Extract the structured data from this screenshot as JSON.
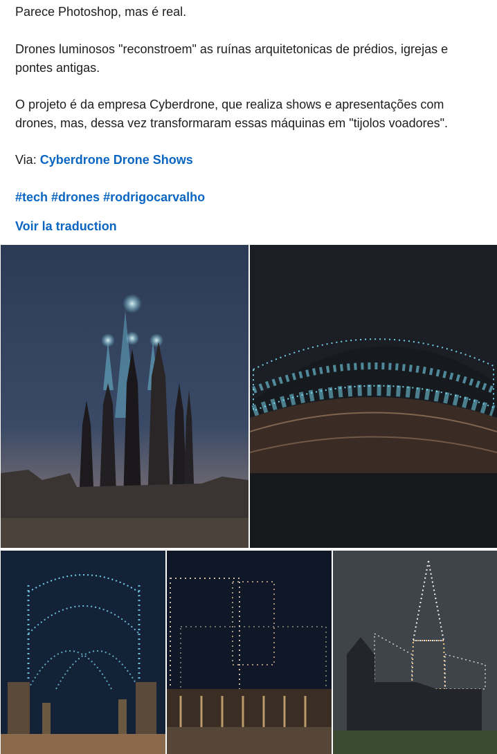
{
  "post": {
    "line1": "Parece Photoshop, mas é real.",
    "line2a": "Drones luminosos \"reconstroem\" as ruínas arquitetonicas de prédios, igrejas e",
    "line2b": "pontes antigas.",
    "line3a": "O projeto é da empresa Cyberdrone, que realiza shows e apresentações com",
    "line3b": "drones, mas, dessa vez transformaram essas máquinas em \"tijolos voadores\".",
    "via_label": "Via:",
    "via_link": "Cyberdrone Drone Shows",
    "hashtags": [
      "#tech",
      "#drones",
      "#rodrigocarvalho"
    ],
    "translate_label": "Voir la traduction"
  },
  "images": [
    {
      "name": "sagrada-familia-drones",
      "kind": "photo"
    },
    {
      "name": "colosseum-drones",
      "kind": "photo"
    },
    {
      "name": "ruined-arches-drones",
      "kind": "photo"
    },
    {
      "name": "ancient-facade-drones",
      "kind": "photo"
    },
    {
      "name": "abbey-spire-drones",
      "kind": "photo"
    }
  ],
  "colors": {
    "link": "#0a66c2",
    "text": "#1d1d1d",
    "drone_light": "#7fe6ff"
  }
}
